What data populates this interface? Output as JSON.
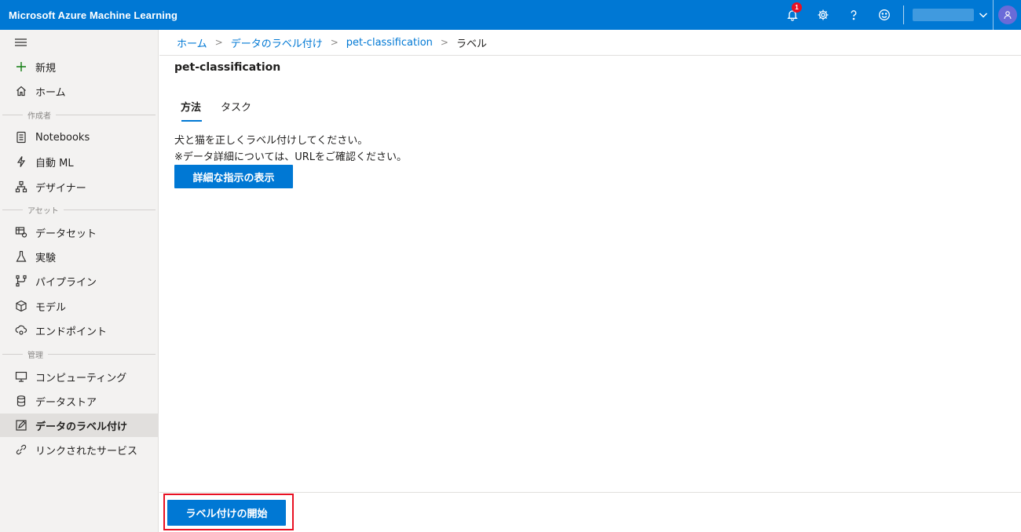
{
  "app": {
    "title": "Microsoft Azure Machine Learning"
  },
  "topbar": {
    "notification_count": "1",
    "icons": [
      "bell-icon",
      "gear-icon",
      "help-icon",
      "smiley-icon",
      "chevron-down-icon",
      "person-icon"
    ]
  },
  "sidebar": {
    "items": [
      {
        "label": "新規",
        "icon": "plus-icon"
      },
      {
        "label": "ホーム",
        "icon": "home-icon"
      },
      {
        "label": "Notebooks",
        "icon": "notebook-icon"
      },
      {
        "label": "自動 ML",
        "icon": "automl-icon"
      },
      {
        "label": "デザイナー",
        "icon": "designer-icon"
      },
      {
        "label": "データセット",
        "icon": "dataset-icon"
      },
      {
        "label": "実験",
        "icon": "flask-icon"
      },
      {
        "label": "パイプライン",
        "icon": "pipeline-icon"
      },
      {
        "label": "モデル",
        "icon": "cube-icon"
      },
      {
        "label": "エンドポイント",
        "icon": "endpoint-icon"
      },
      {
        "label": "コンピューティング",
        "icon": "monitor-icon"
      },
      {
        "label": "データストア",
        "icon": "database-icon"
      },
      {
        "label": "データのラベル付け",
        "icon": "label-edit-icon"
      },
      {
        "label": "リンクされたサービス",
        "icon": "link-icon"
      }
    ],
    "sections": [
      "作成者",
      "アセット",
      "管理"
    ]
  },
  "breadcrumb": {
    "items": [
      "ホーム",
      "データのラベル付け",
      "pet-classification",
      "ラベル"
    ]
  },
  "main": {
    "title": "pet-classification",
    "tabs": [
      {
        "label": "方法"
      },
      {
        "label": "タスク"
      }
    ],
    "instructions": [
      "犬と猫を正しくラベル付けしてください。",
      "※データ詳細については、URLをご確認ください。"
    ],
    "details_button": "詳細な指示の表示",
    "start_button": "ラベル付けの開始"
  },
  "colors": {
    "accent": "#0078d4",
    "highlight": "#e81123",
    "avatar": "#6a6bd8"
  }
}
